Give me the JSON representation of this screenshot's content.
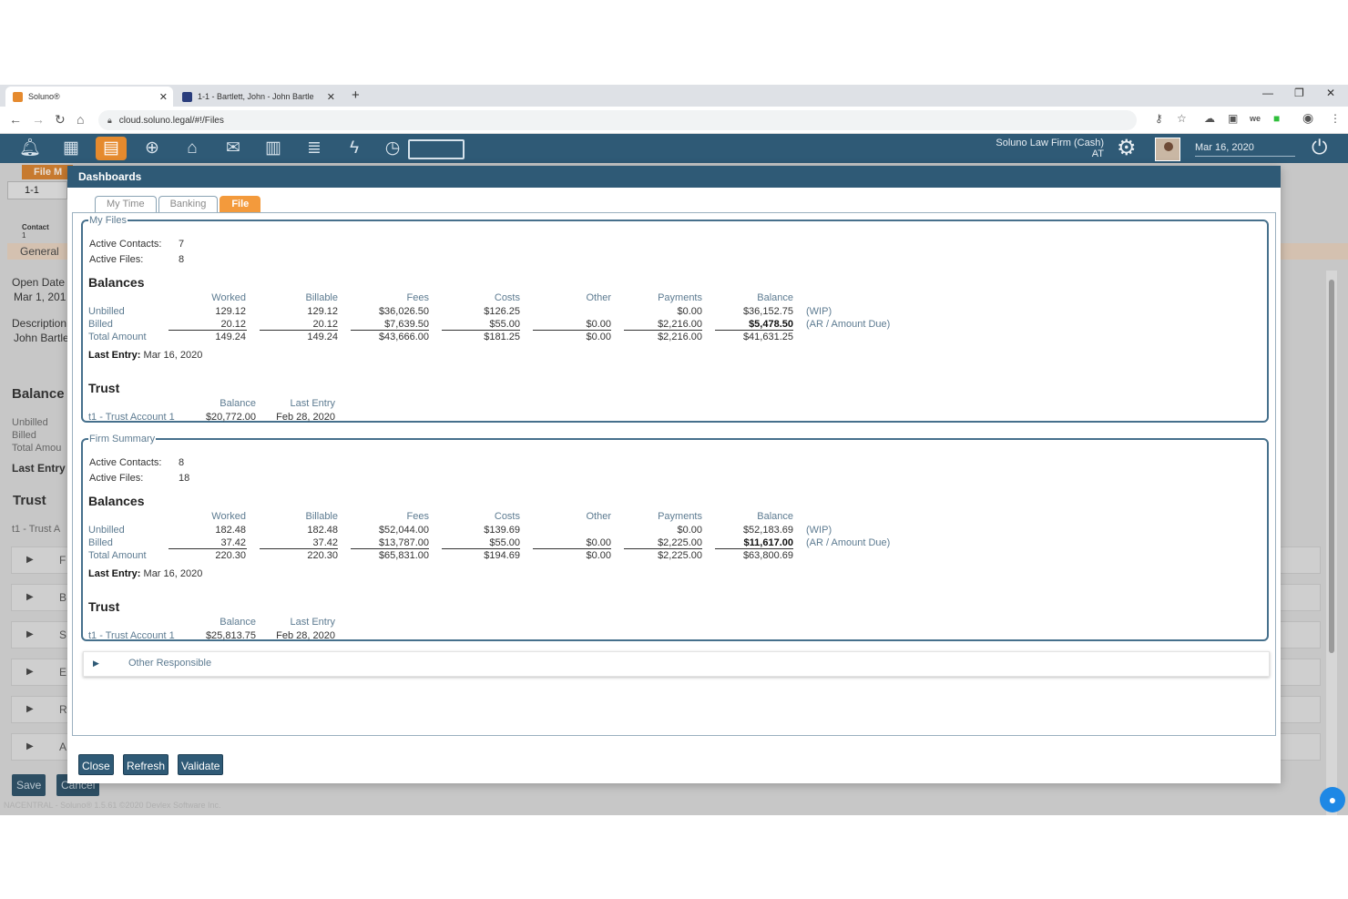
{
  "browser": {
    "tabs": [
      {
        "title": "Soluno®"
      },
      {
        "title": "1-1 - Bartlett, John - John Bartle"
      }
    ],
    "url": "cloud.soluno.legal/#!/Files"
  },
  "toolbar": {
    "firm_name": "Soluno Law Firm (Cash)",
    "user_initials": "AT",
    "date": "Mar 16, 2020"
  },
  "background": {
    "file_tab": "File M",
    "file_number": "1-1",
    "contact_label": "Contact",
    "contact_value": "1",
    "general_tab": "General",
    "open_date_label": "Open Date",
    "open_date_value": "Mar 1, 201",
    "description_label": "Description",
    "description_value": "John Bartle",
    "balances_heading": "Balance",
    "unbilled": "Unbilled",
    "billed": "Billed",
    "total_amount": "Total Amou",
    "last_entry": "Last Entry",
    "trust_heading": "Trust",
    "trust_account": "t1 - Trust A",
    "accordion_letters": [
      "F",
      "B",
      "S",
      "E",
      "R",
      "A"
    ],
    "save_button": "Save",
    "cancel_button": "Cancel",
    "footer": "NACENTRAL - Soluno® 1.5.61 ©2020 Devlex Software Inc."
  },
  "dialog": {
    "title": "Dashboards",
    "tabs": [
      {
        "label": "My Time",
        "active": false
      },
      {
        "label": "Banking",
        "active": false
      },
      {
        "label": "File",
        "active": true
      }
    ],
    "columns": [
      "Worked",
      "Billable",
      "Fees",
      "Costs",
      "Other",
      "Payments",
      "Balance"
    ],
    "row_labels": [
      "Unbilled",
      "Billed",
      "Total Amount"
    ],
    "notes": [
      "(WIP)",
      "(AR / Amount Due)"
    ],
    "last_entry_label": "Last Entry:",
    "trust_columns": [
      "Balance",
      "Last Entry"
    ],
    "sections": [
      {
        "legend": "My Files",
        "active_contacts_label": "Active Contacts:",
        "active_contacts": "7",
        "active_files_label": "Active Files:",
        "active_files": "8",
        "balances_heading": "Balances",
        "rows": [
          [
            "129.12",
            "129.12",
            "$36,026.50",
            "$126.25",
            "",
            "$0.00",
            "$36,152.75"
          ],
          [
            "20.12",
            "20.12",
            "$7,639.50",
            "$55.00",
            "$0.00",
            "$2,216.00",
            "$5,478.50"
          ],
          [
            "149.24",
            "149.24",
            "$43,666.00",
            "$181.25",
            "$0.00",
            "$2,216.00",
            "$41,631.25"
          ]
        ],
        "last_entry": "Mar 16, 2020",
        "trust_heading": "Trust",
        "trust_rows": [
          {
            "account": "t1 - Trust Account 1",
            "balance": "$20,772.00",
            "last_entry": "Feb 28, 2020"
          }
        ]
      },
      {
        "legend": "Firm Summary",
        "active_contacts_label": "Active Contacts:",
        "active_contacts": "8",
        "active_files_label": "Active Files:",
        "active_files": "18",
        "balances_heading": "Balances",
        "rows": [
          [
            "182.48",
            "182.48",
            "$52,044.00",
            "$139.69",
            "",
            "$0.00",
            "$52,183.69"
          ],
          [
            "37.42",
            "37.42",
            "$13,787.00",
            "$55.00",
            "$0.00",
            "$2,225.00",
            "$11,617.00"
          ],
          [
            "220.30",
            "220.30",
            "$65,831.00",
            "$194.69",
            "$0.00",
            "$2,225.00",
            "$63,800.69"
          ]
        ],
        "last_entry": "Mar 16, 2020",
        "trust_heading": "Trust",
        "trust_rows": [
          {
            "account": "t1 - Trust Account 1",
            "balance": "$25,813.75",
            "last_entry": "Feb 28, 2020"
          }
        ]
      }
    ],
    "other_responsible": "Other Responsible",
    "buttons": {
      "close": "Close",
      "refresh": "Refresh",
      "validate": "Validate"
    }
  },
  "colors": {
    "header": "#2f5a76",
    "accent": "#f39a3c",
    "label": "#5d7b91"
  }
}
